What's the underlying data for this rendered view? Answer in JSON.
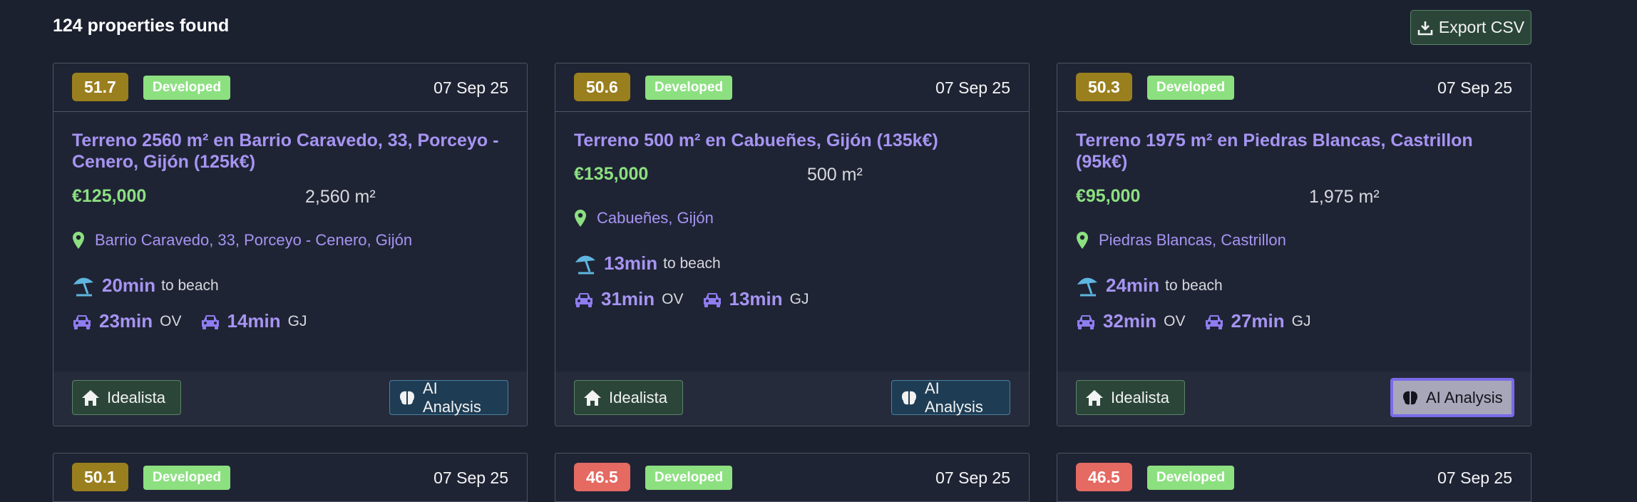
{
  "header": {
    "count_text": "124 properties found",
    "export_label": "Export CSV"
  },
  "colors": {
    "background": "#1c2130",
    "accent_purple": "#a694f2",
    "price_green": "#8ce080",
    "score_gold": "#9a7f1e",
    "score_red": "#e46a62"
  },
  "cards": [
    {
      "score": "51.7",
      "score_color": "#9a7f1e",
      "status": "Developed",
      "date": "07 Sep 25",
      "title": "Terreno 2560 m² en Barrio Caravedo, 33, Porceyo - Cenero, Gijón (125k€)",
      "price": "€125,000",
      "area": "2,560 m²",
      "location": "Barrio Caravedo, 33, Porceyo - Cenero, Gijón",
      "beach_time": "20min",
      "beach_label": "to beach",
      "drive1_time": "23min",
      "drive1_code": "OV",
      "drive2_time": "14min",
      "drive2_code": "GJ",
      "idealista_label": "Idealista",
      "ai_label": "AI Analysis"
    },
    {
      "score": "50.6",
      "score_color": "#9a7f1e",
      "status": "Developed",
      "date": "07 Sep 25",
      "title": "Terreno 500 m² en Cabueñes, Gijón (135k€)",
      "price": "€135,000",
      "area": "500 m²",
      "location": "Cabueñes, Gijón",
      "beach_time": "13min",
      "beach_label": "to beach",
      "drive1_time": "31min",
      "drive1_code": "OV",
      "drive2_time": "13min",
      "drive2_code": "GJ",
      "idealista_label": "Idealista",
      "ai_label": "AI Analysis"
    },
    {
      "score": "50.3",
      "score_color": "#9a7f1e",
      "status": "Developed",
      "date": "07 Sep 25",
      "title": "Terreno 1975 m² en Piedras Blancas, Castrillon (95k€)",
      "price": "€95,000",
      "area": "1,975 m²",
      "location": "Piedras Blancas, Castrillon",
      "beach_time": "24min",
      "beach_label": "to beach",
      "drive1_time": "32min",
      "drive1_code": "OV",
      "drive2_time": "27min",
      "drive2_code": "GJ",
      "idealista_label": "Idealista",
      "ai_label": "AI Analysis"
    },
    {
      "score": "50.1",
      "score_color": "#9a7f1e",
      "status": "Developed",
      "date": "07 Sep 25"
    },
    {
      "score": "46.5",
      "score_color": "#e46a62",
      "status": "Developed",
      "date": "07 Sep 25"
    },
    {
      "score": "46.5",
      "score_color": "#e46a62",
      "status": "Developed",
      "date": "07 Sep 25"
    }
  ]
}
